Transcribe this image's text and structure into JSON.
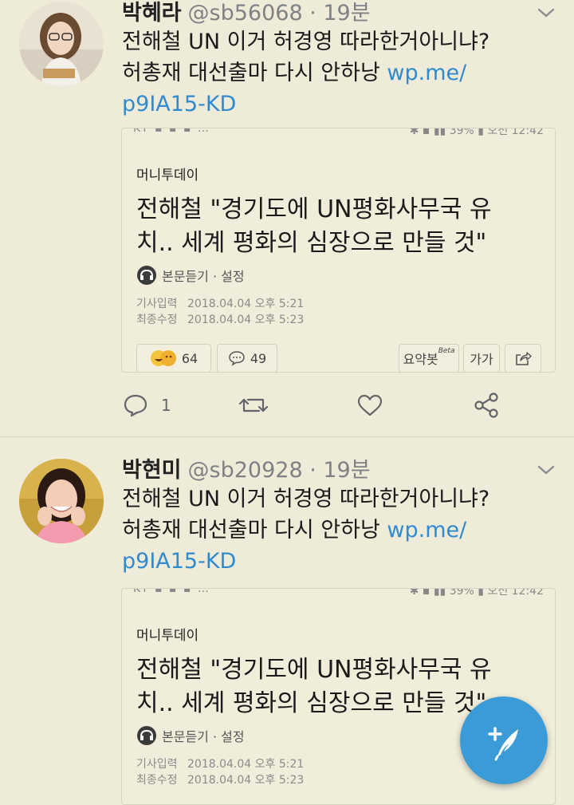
{
  "tweets": [
    {
      "name": "박혜라",
      "handle": "@sb56068 · 19분",
      "line1": "전해철 UN 이거 허경영 따라한거아니냐?",
      "line2": "허총재 대선출마 다시 안하낭",
      "link1": "wp.me/",
      "link2": "p9IA15-KD",
      "card": {
        "source": "머니투데이",
        "headline1": "전해철 \"경기도에 UN평화사무국 유",
        "headline2": "치.. 세계 평화의 심장으로 만들 것\"",
        "listen": "본문듣기 · 설정",
        "input_label": "기사입력",
        "input_date": "2018.04.04 오후 5:21",
        "edit_label": "최종수정",
        "edit_date": "2018.04.04 오후 5:23",
        "reactions": "64",
        "comments": "49",
        "summary_bot": "요약봇",
        "beta": "Beta",
        "font_size": "가가"
      },
      "reply_count": "1"
    },
    {
      "name": "박현미",
      "handle": "@sb20928 · 19분",
      "line1": "전해철 UN 이거 허경영 따라한거아니냐?",
      "line2": "허총재 대선출마 다시 안하낭",
      "link1": "wp.me/",
      "link2": "p9IA15-KD",
      "card": {
        "source": "머니투데이",
        "headline1": "전해철 \"경기도에 UN평화사무국 유",
        "headline2": "치.. 세계 평화의 심장으로 만들 것\"",
        "listen": "본문듣기 · 설정",
        "input_label": "기사입력",
        "input_date": "2018.04.04 오후 5:21",
        "edit_label": "최종수정",
        "edit_date": "2018.04.04 오후 5:23"
      }
    }
  ],
  "icons": {
    "reply": "reply-icon",
    "retweet": "retweet-icon",
    "like": "heart-icon",
    "share": "share-icon",
    "compose": "compose-tweet-icon"
  },
  "colors": {
    "background": "#efebd9",
    "link": "#2f8ad0",
    "fab": "#3b9bd7"
  }
}
